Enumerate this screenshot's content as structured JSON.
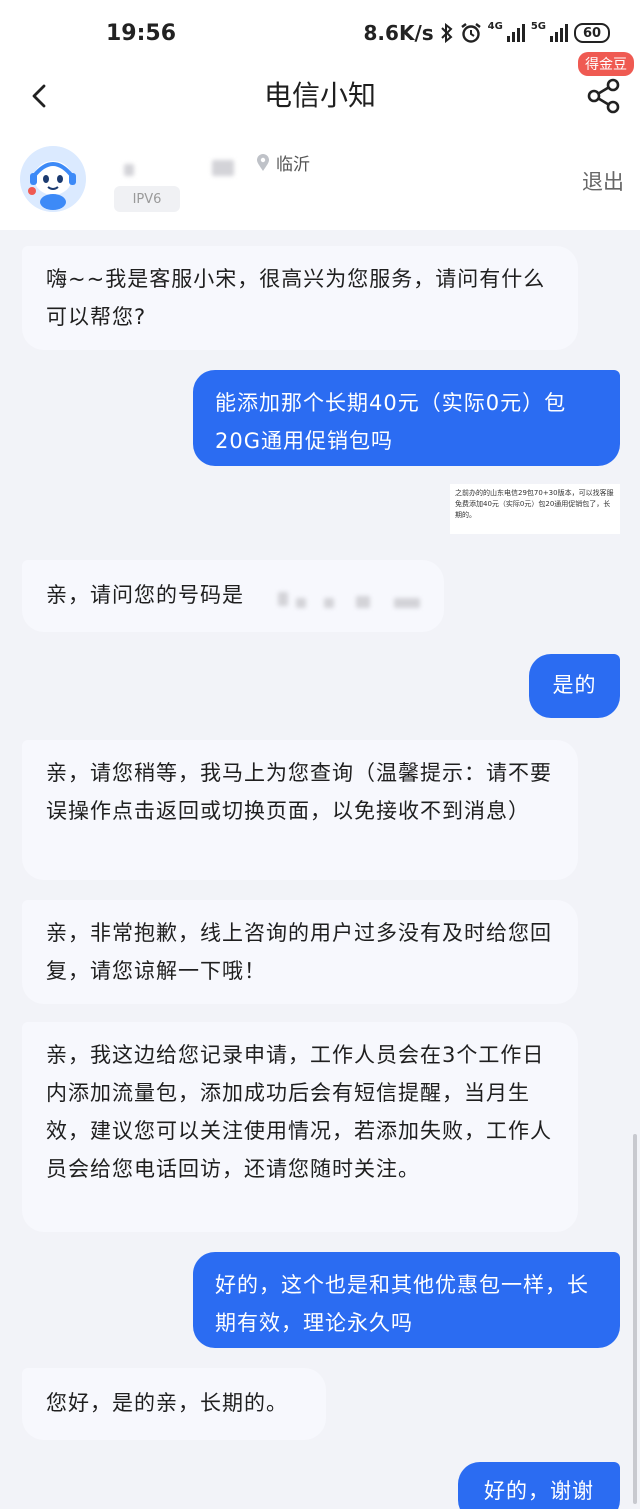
{
  "status_bar": {
    "time": "19:56",
    "net_speed": "8.6K/s",
    "net_4g": "4G",
    "net_5g": "5G",
    "battery": "60",
    "icons": [
      "bluetooth-icon",
      "alarm-icon",
      "signal-icon",
      "battery-icon"
    ]
  },
  "nav": {
    "title": "电信小知",
    "badge": "得金豆",
    "back_icon": "chevron-left-icon",
    "share_icon": "share-icon"
  },
  "header": {
    "location": "临沂",
    "ipv6": "IPV6",
    "exit_label": "退出"
  },
  "messages": [
    {
      "side": "left",
      "text": "嗨~~我是客服小宋，很高兴为您服务，请问有什么可以帮您?"
    },
    {
      "side": "right",
      "text": "能添加那个长期40元（实际0元）包20G通用促销包吗"
    },
    {
      "side": "right-image",
      "text": "之前办的的山东电信29包70+30版本，可以找客服免费添加40元（实际0元）包20通用促销包了，长期的。"
    },
    {
      "side": "left",
      "text": "亲，请问您的号码是"
    },
    {
      "side": "right",
      "text": "是的"
    },
    {
      "side": "left",
      "text": "亲，请您稍等，我马上为您查询（温馨提示：请不要误操作点击返回或切换页面，以免接收不到消息）"
    },
    {
      "side": "left",
      "text": "亲，非常抱歉，线上咨询的用户过多没有及时给您回复，请您谅解一下哦！"
    },
    {
      "side": "left",
      "text": "亲，我这边给您记录申请，工作人员会在3个工作日内添加流量包，添加成功后会有短信提醒，当月生效，建议您可以关注使用情况，若添加失败，工作人员会给您电话回访，还请您随时关注。"
    },
    {
      "side": "right",
      "text": "好的，这个也是和其他优惠包一样，长期有效，理论永久吗"
    },
    {
      "side": "left",
      "text": "您好，是的亲，长期的。"
    },
    {
      "side": "right",
      "text": "好的，谢谢"
    }
  ],
  "colors": {
    "accent": "#2b6cf2",
    "badge": "#ef5a52",
    "bubble_left": "#f7f8fd",
    "background": "#f2f3f8"
  }
}
